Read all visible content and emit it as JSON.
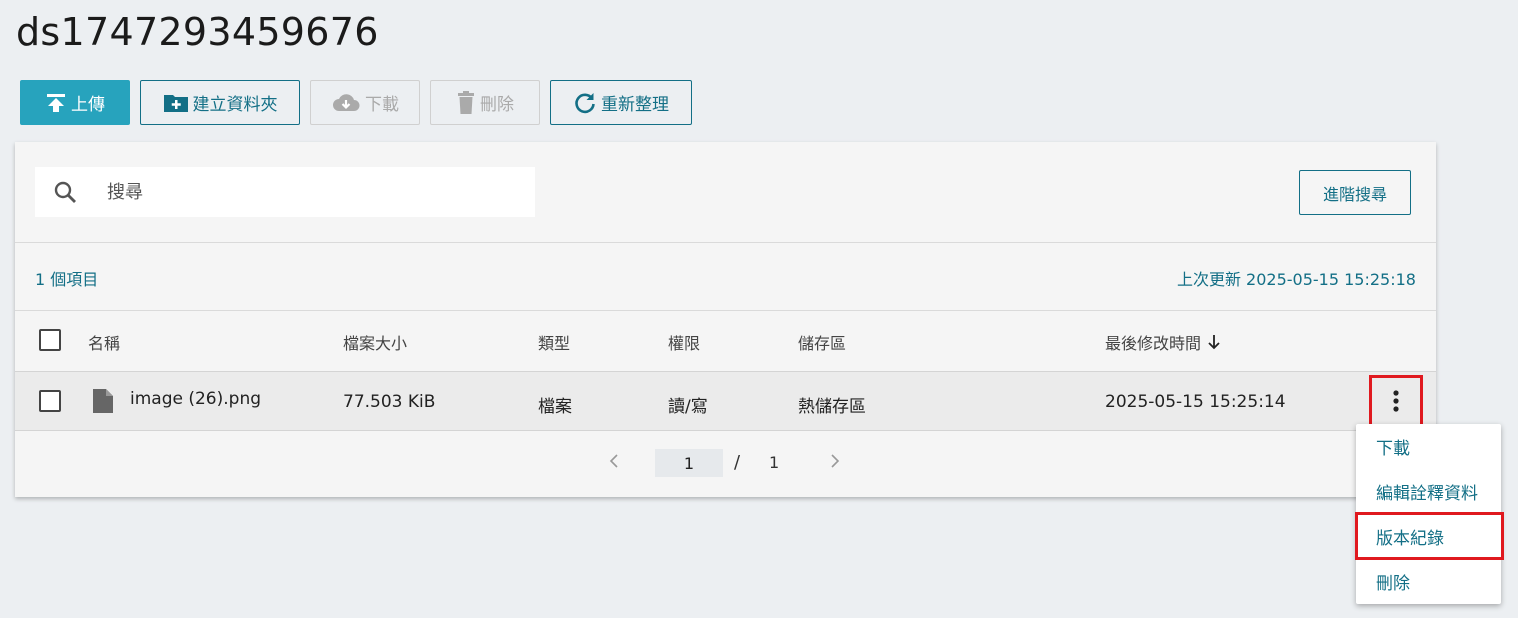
{
  "page": {
    "title": "ds1747293459676"
  },
  "toolbar": {
    "upload": "上傳",
    "new_folder": "建立資料夾",
    "download": "下載",
    "delete": "刪除",
    "refresh": "重新整理"
  },
  "search": {
    "placeholder": "搜尋",
    "value": "",
    "advanced": "進階搜尋"
  },
  "summary": {
    "count": "1 個項目",
    "last_update": "上次更新 2025-05-15 15:25:18"
  },
  "table": {
    "headers": {
      "name": "名稱",
      "size": "檔案大小",
      "type": "類型",
      "permission": "權限",
      "storage": "儲存區",
      "modified": "最後修改時間"
    },
    "rows": [
      {
        "name": "image (26).png",
        "size": "77.503 KiB",
        "type": "檔案",
        "permission": "讀/寫",
        "storage": "熱儲存區",
        "modified": "2025-05-15 15:25:14"
      }
    ]
  },
  "pagination": {
    "current": "1",
    "separator": "/",
    "total": "1"
  },
  "context_menu": {
    "items": [
      "下載",
      "編輯詮釋資料",
      "版本紀錄",
      "刪除"
    ]
  },
  "colors": {
    "primary": "#27a3bd",
    "accent_text": "#136f86",
    "highlight_border": "#e0191f"
  }
}
